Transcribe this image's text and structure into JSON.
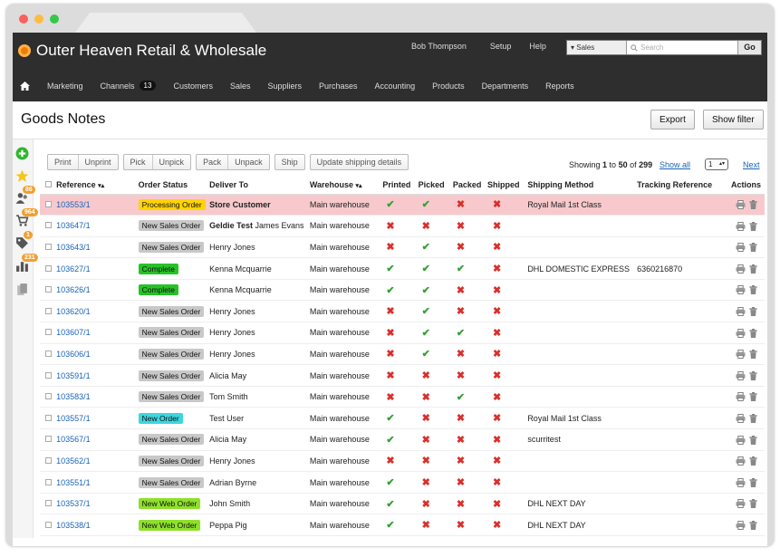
{
  "app": {
    "brand": "Outer Heaven Retail & Wholesale",
    "user": "Bob Thompson",
    "setup": "Setup",
    "help": "Help",
    "search_scope": "Sales",
    "search_placeholder": "Search",
    "go_label": "Go"
  },
  "nav": {
    "items": [
      "Marketing",
      "Channels",
      "Customers",
      "Sales",
      "Suppliers",
      "Purchases",
      "Accounting",
      "Products",
      "Departments",
      "Reports"
    ],
    "channels_count": "13"
  },
  "page": {
    "title": "Goods Notes",
    "export_label": "Export",
    "filter_label": "Show filter"
  },
  "sidebar_badges": [
    "86",
    "964",
    "1",
    "231"
  ],
  "toolbar": {
    "print": "Print",
    "unprint": "Unprint",
    "pick": "Pick",
    "unpick": "Unpick",
    "pack": "Pack",
    "unpack": "Unpack",
    "ship": "Ship",
    "update": "Update shipping details"
  },
  "paging": {
    "showing_prefix": "Showing ",
    "from": "1",
    "to_word": " to ",
    "to": "50",
    "of_word": " of ",
    "total": "299",
    "show_all": "Show all",
    "page": "1",
    "next": "Next"
  },
  "columns": {
    "reference": "Reference",
    "status": "Order Status",
    "deliver": "Deliver To",
    "warehouse": "Warehouse",
    "printed": "Printed",
    "picked": "Picked",
    "packed": "Packed",
    "shipped": "Shipped",
    "method": "Shipping Method",
    "tracking": "Tracking Reference",
    "actions": "Actions"
  },
  "status_colors": {
    "Processing Order": "#ffd400",
    "New Sales Order": "#c8c8c8",
    "Complete": "#27c227",
    "New Order": "#3dd6e0",
    "New Web Order": "#8ee02a"
  },
  "rows": [
    {
      "ref": "103553/1",
      "status": "Processing Order",
      "deliver_bold": "Store Customer",
      "deliver": "",
      "warehouse": "Main warehouse",
      "printed": "check",
      "picked": "check",
      "packed": "x",
      "shipped": "x",
      "method": "Royal Mail 1st Class",
      "tracking": "",
      "highlight": true
    },
    {
      "ref": "103647/1",
      "status": "New Sales Order",
      "deliver_bold": "Geldie Test",
      "deliver": " James Evans",
      "warehouse": "Main warehouse",
      "printed": "x",
      "picked": "x",
      "packed": "x",
      "shipped": "x",
      "method": "",
      "tracking": ""
    },
    {
      "ref": "103643/1",
      "status": "New Sales Order",
      "deliver_bold": "",
      "deliver": "Henry Jones",
      "warehouse": "Main warehouse",
      "printed": "x",
      "picked": "check",
      "packed": "x",
      "shipped": "x",
      "method": "",
      "tracking": ""
    },
    {
      "ref": "103627/1",
      "status": "Complete",
      "deliver_bold": "",
      "deliver": "Kenna Mcquarrie",
      "warehouse": "Main warehouse",
      "printed": "check",
      "picked": "check",
      "packed": "check",
      "shipped": "x",
      "method": "DHL DOMESTIC EXPRESS",
      "tracking": "6360216870"
    },
    {
      "ref": "103626/1",
      "status": "Complete",
      "deliver_bold": "",
      "deliver": "Kenna Mcquarrie",
      "warehouse": "Main warehouse",
      "printed": "check",
      "picked": "check",
      "packed": "x",
      "shipped": "x",
      "method": "",
      "tracking": ""
    },
    {
      "ref": "103620/1",
      "status": "New Sales Order",
      "deliver_bold": "",
      "deliver": "Henry Jones",
      "warehouse": "Main warehouse",
      "printed": "x",
      "picked": "check",
      "packed": "x",
      "shipped": "x",
      "method": "",
      "tracking": ""
    },
    {
      "ref": "103607/1",
      "status": "New Sales Order",
      "deliver_bold": "",
      "deliver": "Henry Jones",
      "warehouse": "Main warehouse",
      "printed": "x",
      "picked": "check",
      "packed": "check",
      "shipped": "x",
      "method": "",
      "tracking": ""
    },
    {
      "ref": "103606/1",
      "status": "New Sales Order",
      "deliver_bold": "",
      "deliver": "Henry Jones",
      "warehouse": "Main warehouse",
      "printed": "x",
      "picked": "check",
      "packed": "x",
      "shipped": "x",
      "method": "",
      "tracking": ""
    },
    {
      "ref": "103591/1",
      "status": "New Sales Order",
      "deliver_bold": "",
      "deliver": "Alicia May",
      "warehouse": "Main warehouse",
      "printed": "x",
      "picked": "x",
      "packed": "x",
      "shipped": "x",
      "method": "",
      "tracking": ""
    },
    {
      "ref": "103583/1",
      "status": "New Sales Order",
      "deliver_bold": "",
      "deliver": "Tom Smith",
      "warehouse": "Main warehouse",
      "printed": "x",
      "picked": "x",
      "packed": "check",
      "shipped": "x",
      "method": "",
      "tracking": ""
    },
    {
      "ref": "103557/1",
      "status": "New Order",
      "deliver_bold": "",
      "deliver": "Test User",
      "warehouse": "Main warehouse",
      "printed": "check",
      "picked": "x",
      "packed": "x",
      "shipped": "x",
      "method": "Royal Mail 1st Class",
      "tracking": ""
    },
    {
      "ref": "103567/1",
      "status": "New Sales Order",
      "deliver_bold": "",
      "deliver": "Alicia May",
      "warehouse": "Main warehouse",
      "printed": "check",
      "picked": "x",
      "packed": "x",
      "shipped": "x",
      "method": "scurritest",
      "tracking": ""
    },
    {
      "ref": "103562/1",
      "status": "New Sales Order",
      "deliver_bold": "",
      "deliver": "Henry Jones",
      "warehouse": "Main warehouse",
      "printed": "x",
      "picked": "x",
      "packed": "x",
      "shipped": "x",
      "method": "",
      "tracking": ""
    },
    {
      "ref": "103551/1",
      "status": "New Sales Order",
      "deliver_bold": "",
      "deliver": "Adrian Byrne",
      "warehouse": "Main warehouse",
      "printed": "check",
      "picked": "x",
      "packed": "x",
      "shipped": "x",
      "method": "",
      "tracking": ""
    },
    {
      "ref": "103537/1",
      "status": "New Web Order",
      "deliver_bold": "",
      "deliver": "John Smith",
      "warehouse": "Main warehouse",
      "printed": "check",
      "picked": "x",
      "packed": "x",
      "shipped": "x",
      "method": "DHL NEXT DAY",
      "tracking": ""
    },
    {
      "ref": "103538/1",
      "status": "New Web Order",
      "deliver_bold": "",
      "deliver": "Peppa Pig",
      "warehouse": "Main warehouse",
      "printed": "check",
      "picked": "x",
      "packed": "x",
      "shipped": "x",
      "method": "DHL NEXT DAY",
      "tracking": ""
    }
  ]
}
